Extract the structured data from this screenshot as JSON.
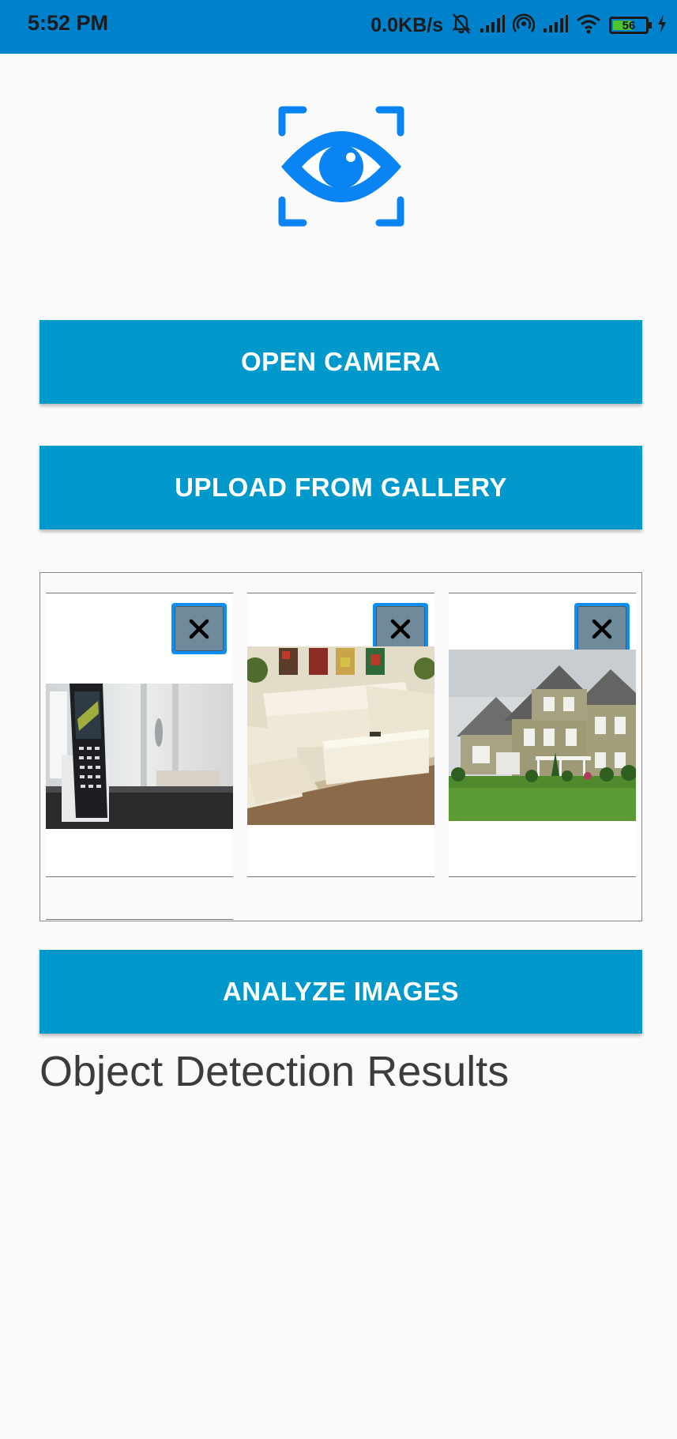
{
  "status_bar": {
    "time": "5:52 PM",
    "network_speed": "0.0KB/s",
    "battery_level": "56",
    "icons": [
      "mute-bell-icon",
      "signal-icon",
      "hotspot-icon",
      "signal-icon",
      "wifi-icon",
      "battery-icon",
      "charging-icon"
    ]
  },
  "app": {
    "logo_icon": "eye-scan-icon",
    "accent_color": "#0199cc",
    "logo_color": "#0a84f2"
  },
  "buttons": {
    "open_camera": "OPEN CAMERA",
    "upload_gallery": "UPLOAD FROM GALLERY",
    "analyze": "ANALYZE IMAGES"
  },
  "gallery": {
    "items": [
      {
        "image": "cordless-phone-photo",
        "remove_icon": "close-icon"
      },
      {
        "image": "living-room-sofa-photo",
        "remove_icon": "close-icon"
      },
      {
        "image": "suburban-house-photo",
        "remove_icon": "close-icon"
      }
    ]
  },
  "results": {
    "title": "Object Detection Results"
  }
}
